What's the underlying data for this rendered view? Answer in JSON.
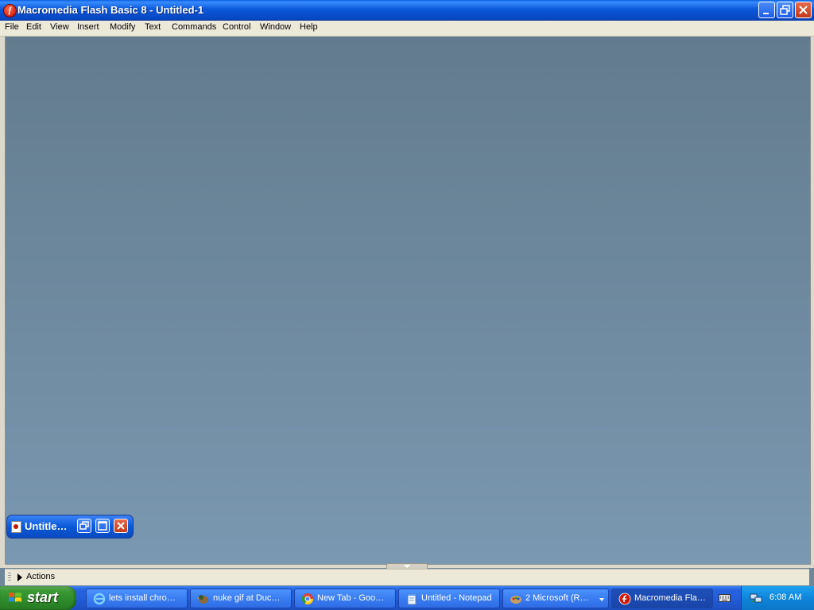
{
  "window": {
    "title": "Macromedia Flash Basic 8 - Untitled-1",
    "app_icon_letter": "f",
    "buttons": [
      "minimize",
      "restore",
      "close"
    ]
  },
  "menu": {
    "items": [
      "File",
      "Edit",
      "View",
      "Insert",
      "Modify",
      "Text",
      "Commands",
      "Control",
      "Window",
      "Help"
    ]
  },
  "document": {
    "minimized_title": "Untitle…"
  },
  "actions_panel": {
    "label": "Actions"
  },
  "taskbar": {
    "start_label": "start",
    "tasks": [
      {
        "label": "lets install chro…",
        "icon": "internet-explorer-icon"
      },
      {
        "label": "nuke gif at Duc…",
        "icon": "duck-icon"
      },
      {
        "label": "New Tab - Goo…",
        "icon": "chrome-icon"
      },
      {
        "label": "Untitled - Notepad",
        "icon": "notepad-icon"
      },
      {
        "label": "2 Microsoft (R…",
        "icon": "paint-icon"
      },
      {
        "label": "Macromedia Fla…",
        "icon": "flash-icon"
      }
    ],
    "clock": "6:08 AM"
  },
  "colors": {
    "title_bar": "#0a58d8",
    "workspace_top": "#637b8e",
    "workspace_bottom": "#7a98b1",
    "taskbar": "#245edb",
    "start_button": "#3c9a36",
    "tray": "#0f86da"
  }
}
